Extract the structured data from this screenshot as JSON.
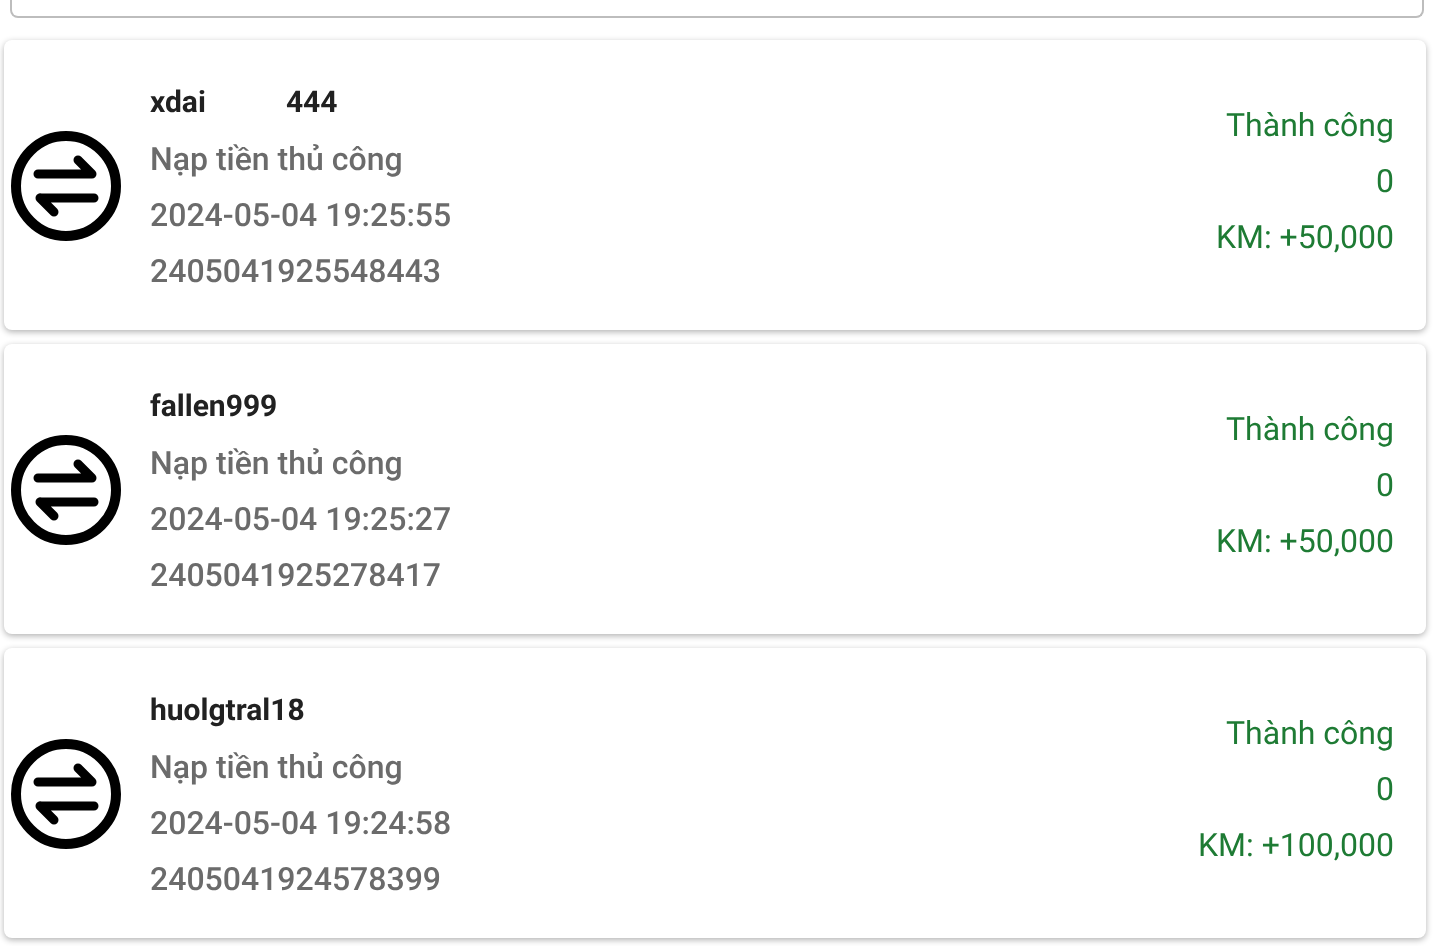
{
  "transactions": [
    {
      "username": [
        "xdai",
        "444"
      ],
      "type": "Nạp tiền thủ công",
      "time": "2024-05-04 19:25:55",
      "code": "2405041925548443",
      "status": "Thành công",
      "amount": "0",
      "bonus": "KM: +50,000"
    },
    {
      "username": [
        "fallen999"
      ],
      "type": "Nạp tiền thủ công",
      "time": "2024-05-04 19:25:27",
      "code": "2405041925278417",
      "status": "Thành công",
      "amount": "0",
      "bonus": "KM: +50,000"
    },
    {
      "username": [
        "huolgtral18"
      ],
      "type": "Nạp tiền thủ công",
      "time": "2024-05-04 19:24:58",
      "code": "2405041924578399",
      "status": "Thành công",
      "amount": "0",
      "bonus": "KM: +100,000"
    }
  ]
}
